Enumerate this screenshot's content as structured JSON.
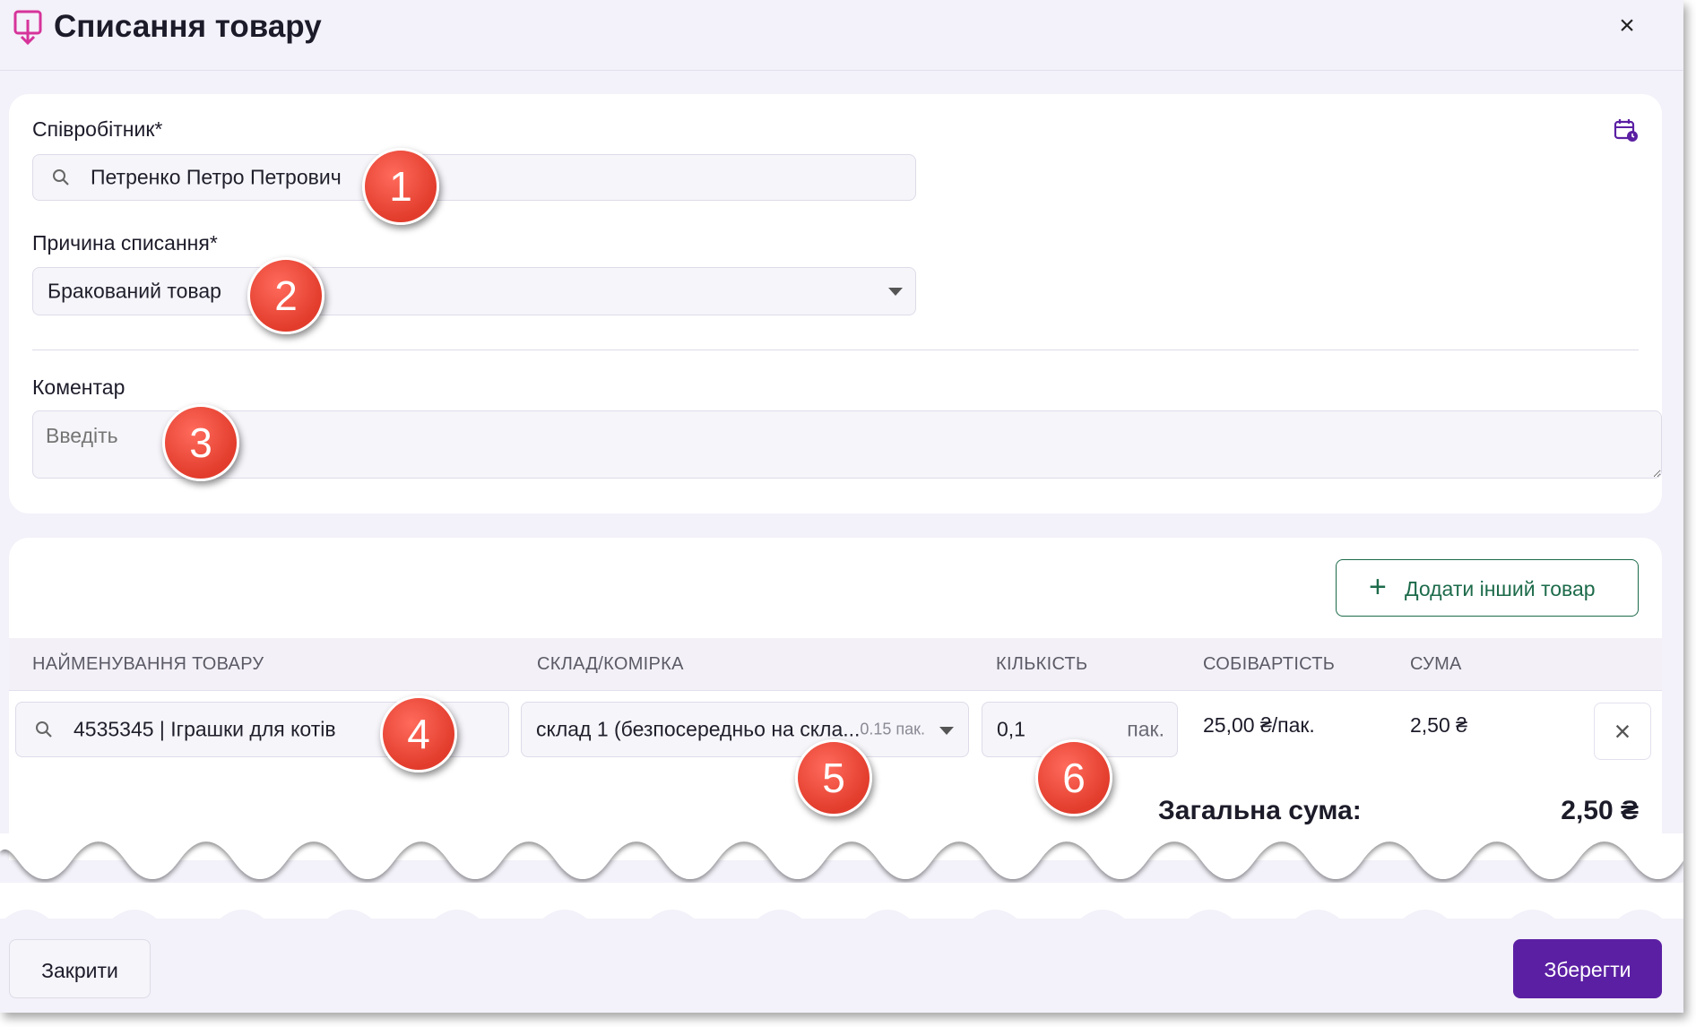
{
  "header": {
    "title": "Списання товару",
    "close_glyph": "×"
  },
  "form": {
    "employee": {
      "label": "Співробітник*",
      "value": "Петренко Петро Петрович"
    },
    "reason": {
      "label": "Причина списання*",
      "value": "Бракований товар"
    },
    "comment": {
      "label": "Коментар",
      "placeholder": "Введіть"
    }
  },
  "products": {
    "add_button_label": "Додати інший товар",
    "columns": [
      "НАЙМЕНУВАННЯ ТОВАРУ",
      "СКЛАД/КОМІРКА",
      "КІЛЬКІСТЬ",
      "СОБІВАРТІСТЬ",
      "СУМА"
    ],
    "rows": [
      {
        "product": "4535345 | Іграшки для котів",
        "warehouse": "склад 1 (безпосередньо на скла...",
        "stock": "0.15 пак.",
        "quantity": "0,1",
        "quantity_unit": "пак.",
        "cost": "25,00 ₴/пак.",
        "sum": "2,50 ₴"
      }
    ],
    "total_label": "Загальна сума:",
    "total_value": "2,50 ₴"
  },
  "annotations": [
    "1",
    "2",
    "3",
    "4",
    "5",
    "6"
  ],
  "footer": {
    "close_label": "Закрити",
    "save_label": "Зберегти"
  },
  "colors": {
    "accent": "#5b1fa3",
    "add_button": "#1d6b4b",
    "badge": "#e23c2c",
    "header_icon": "#d6339a"
  },
  "icons": [
    "download-box-icon",
    "close-icon",
    "calendar-clock-icon",
    "search-icon",
    "chevron-down-icon",
    "plus-icon",
    "resize-handle-icon"
  ]
}
